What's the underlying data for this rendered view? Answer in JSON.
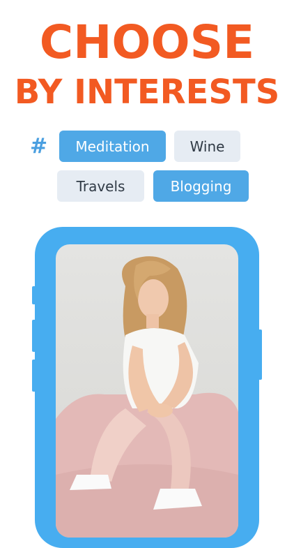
{
  "headline": {
    "line1": "CHOOSE",
    "line2": "BY INTERESTS"
  },
  "tags": {
    "hash_symbol": "#",
    "items": [
      {
        "label": "Meditation",
        "selected": true
      },
      {
        "label": "Wine",
        "selected": false
      },
      {
        "label": "Travels",
        "selected": false
      },
      {
        "label": "Blogging",
        "selected": true
      }
    ]
  },
  "colors": {
    "headline": "#f25a22",
    "accent": "#4fa8e6",
    "chip_unselected": "#e6ecf3",
    "phone_frame": "#47adf0"
  }
}
